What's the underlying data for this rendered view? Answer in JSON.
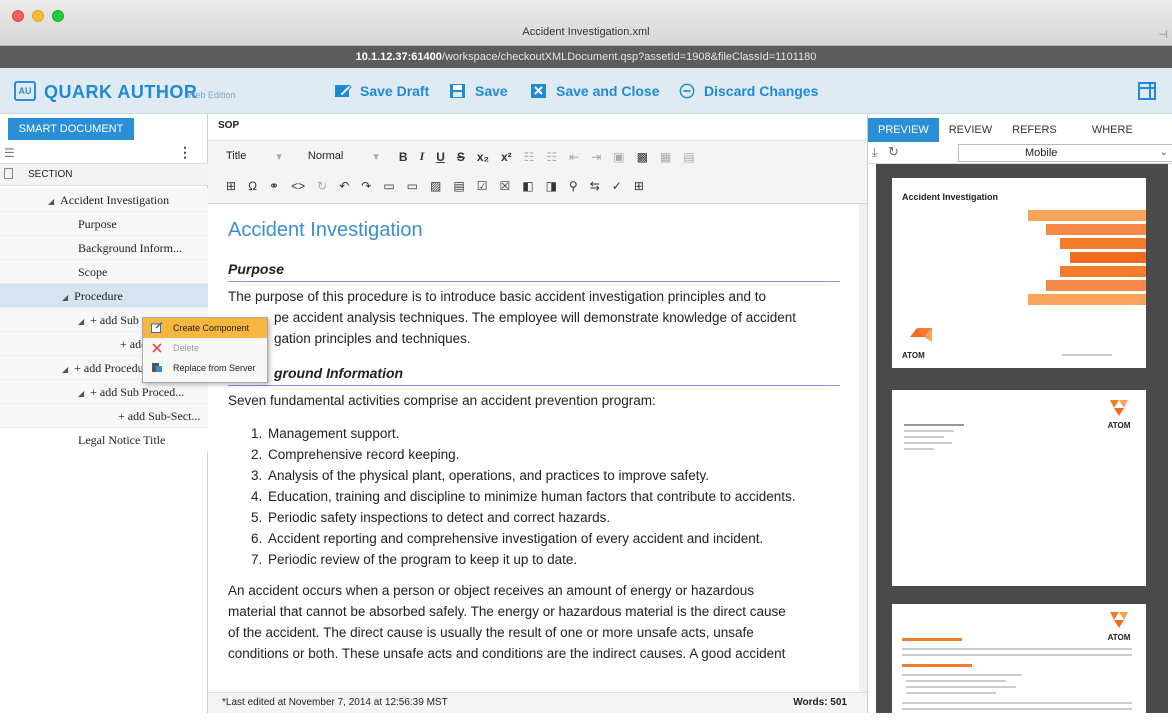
{
  "window": {
    "title": "Accident Investigation.xml",
    "url_host": "10.1.12.37:61400",
    "url_path": "/workspace/checkoutXMLDocument.qsp?assetId=1908&fileClassId=1101180"
  },
  "app": {
    "logo_badge": "AU",
    "logo_name": "QUARK AUTHOR",
    "logo_edition": "Web Edition"
  },
  "toolbar": {
    "save_draft": "Save Draft",
    "save": "Save",
    "save_and_close": "Save and Close",
    "discard_changes": "Discard Changes"
  },
  "left_panel": {
    "tab": "SMART DOCUMENT",
    "section_header": "SECTION",
    "tree": [
      {
        "label": "Accident Investigation",
        "expander": "◢"
      },
      {
        "label": "Purpose"
      },
      {
        "label": "Background Inform..."
      },
      {
        "label": "Scope"
      },
      {
        "label": "Procedure",
        "expander": "◢"
      },
      {
        "label": "+ add Sub",
        "expander": "◢"
      },
      {
        "label": "+ add"
      },
      {
        "label": "+ add Procedure",
        "expander": "◢"
      },
      {
        "label": "+ add Sub Proced...",
        "expander": "◢"
      },
      {
        "label": "+ add Sub-Sect..."
      },
      {
        "label": "Legal Notice Title"
      }
    ]
  },
  "context_menu": {
    "items": [
      {
        "label": "Create Component"
      },
      {
        "label": "Delete"
      },
      {
        "label": "Replace from Server"
      }
    ]
  },
  "editor": {
    "tab": "SOP",
    "style_select": "Title",
    "para_select": "Normal",
    "doc_title": "Accident Investigation",
    "purpose_heading": "Purpose",
    "purpose_line1": "The purpose of this procedure is to introduce basic accident investigation principles and to",
    "purpose_line2": "pe accident analysis techniques. The employee will demonstrate knowledge of accident",
    "purpose_line3": "gation principles and techniques.",
    "background_heading": "ground Information",
    "background_intro": "Seven fundamental activities comprise an accident prevention program:",
    "list": [
      "Management support.",
      "Comprehensive record keeping.",
      "Analysis of the physical plant, operations, and practices to improve safety.",
      "Education, training and discipline to minimize human factors that contribute to accidents.",
      "Periodic safety inspections to detect and correct hazards.",
      "Accident reporting and comprehensive investigation of every accident and incident.",
      "Periodic review of the program to keep it up to date."
    ],
    "para_line1": "An accident occurs when a person or object receives an amount of energy or hazardous",
    "para_line2": "material that cannot be absorbed safely. The energy or hazardous material is the direct cause",
    "para_line3": "of the accident.  The direct cause is usually the result of one or more unsafe acts, unsafe",
    "para_line4": "conditions or both. These unsafe acts and conditions are the indirect causes. A good accident",
    "status_left": "*Last edited at November 7, 2014 at 12:56:39 MST",
    "status_right": "Words: 501"
  },
  "right_panel": {
    "tabs": [
      "PREVIEW",
      "REVIEW",
      "REFERS TO",
      "WHERE USED"
    ],
    "device_select": "Mobile",
    "page1_title": "Accident Investigation",
    "brand": "ATOM"
  },
  "colors": {
    "accent": "#2a8fd6",
    "menu_highlight": "#f6b640",
    "stripe_orange": "#f37b2c"
  }
}
